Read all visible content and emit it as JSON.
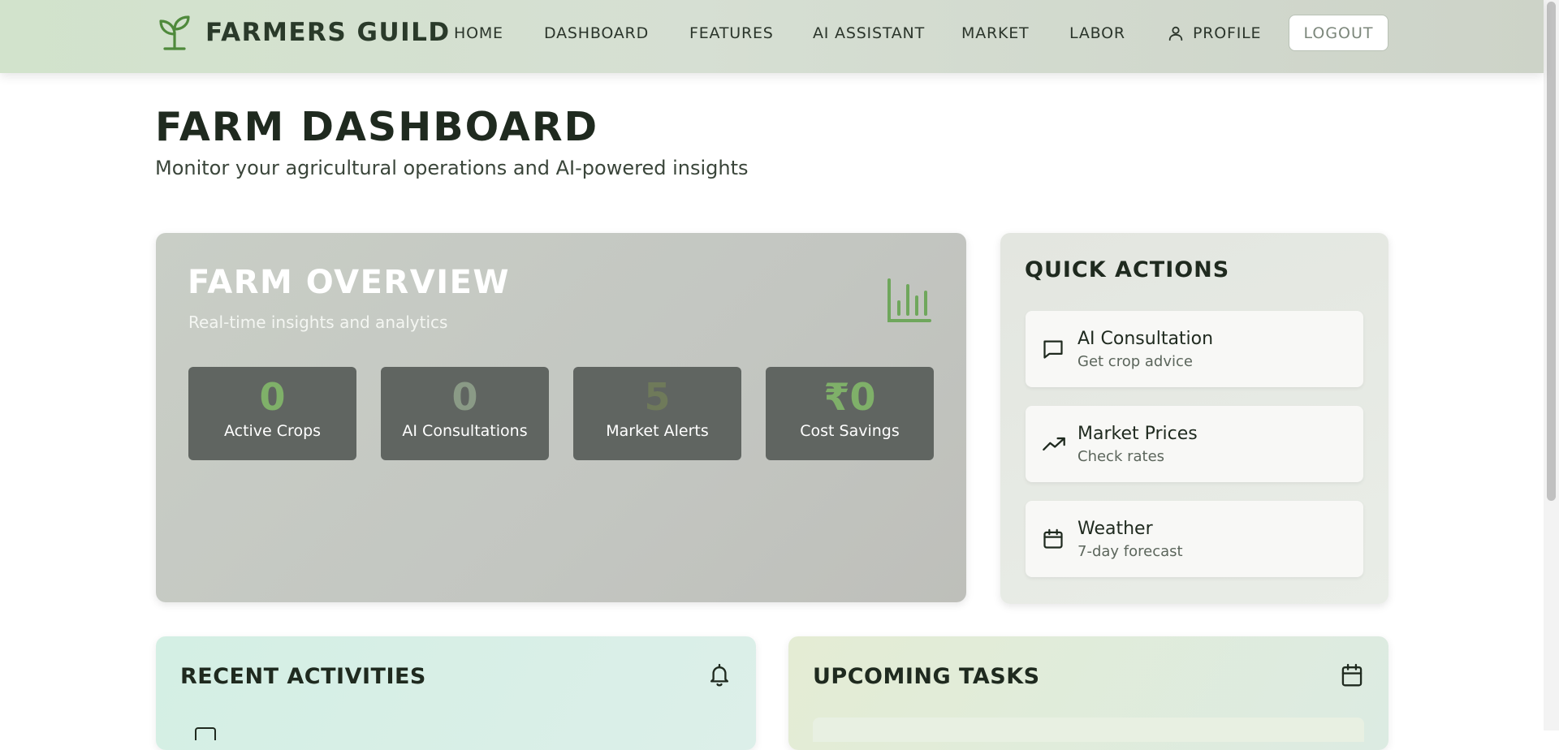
{
  "nav": {
    "brand": "FARMERS GUILD",
    "items": [
      "HOME",
      "DASHBOARD",
      "FEATURES",
      "AI ASSISTANT",
      "MARKET",
      "LABOR"
    ],
    "profile": "PROFILE",
    "logout": "LOGOUT"
  },
  "header": {
    "title": "FARM DASHBOARD",
    "subtitle": "Monitor your agricultural operations and AI-powered insights"
  },
  "overview": {
    "title": "FARM OVERVIEW",
    "subtitle": "Real-time insights and analytics",
    "stats": [
      {
        "value": "0",
        "label": "Active Crops"
      },
      {
        "value": "0",
        "label": "AI Consultations"
      },
      {
        "value": "5",
        "label": "Market Alerts"
      },
      {
        "value": "₹0",
        "label": "Cost Savings"
      }
    ]
  },
  "quick_actions": {
    "title": "QUICK ACTIONS",
    "items": [
      {
        "title": "AI Consultation",
        "subtitle": "Get crop advice",
        "icon": "chat-icon"
      },
      {
        "title": "Market Prices",
        "subtitle": "Check rates",
        "icon": "trending-up-icon"
      },
      {
        "title": "Weather",
        "subtitle": "7-day forecast",
        "icon": "calendar-icon"
      }
    ]
  },
  "recent_activities": {
    "title": "RECENT ACTIVITIES",
    "icon": "bell-icon"
  },
  "upcoming_tasks": {
    "title": "UPCOMING TASKS",
    "icon": "calendar-icon"
  },
  "colors": {
    "accent_green": "#7fb069",
    "nav_bg": "#d6dfd3",
    "stat_tile": "#606561"
  }
}
